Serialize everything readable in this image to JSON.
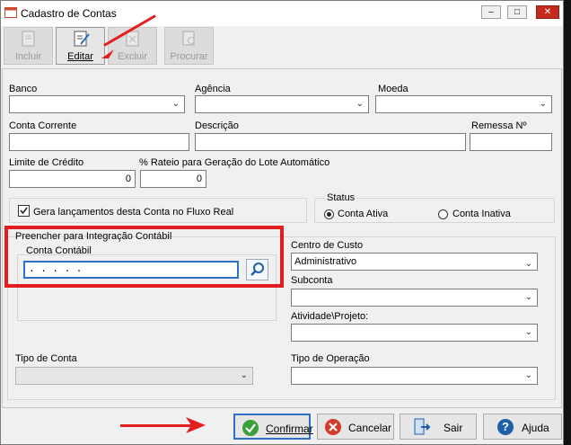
{
  "window": {
    "title": "Cadastro de Contas"
  },
  "toolbar": {
    "incluir": "Incluir",
    "editar": "Editar",
    "excluir": "Excluir",
    "procurar": "Procurar"
  },
  "labels": {
    "banco": "Banco",
    "agencia": "Agência",
    "moeda": "Moeda",
    "conta_corrente": "Conta Corrente",
    "descricao": "Descrição",
    "remessa": "Remessa Nº",
    "limite_credito": "Limite de Crédito",
    "rateio": "% Rateio para Geração do Lote Automático",
    "gera_lancamentos": "Gera lançamentos desta Conta no Fluxo Real",
    "status": "Status",
    "conta_ativa": "Conta Ativa",
    "conta_inativa": "Conta Inativa",
    "integracao": "Preencher para Integração Contábil",
    "conta_contabil": "Conta Contábil",
    "centro_custo": "Centro de Custo",
    "subconta": "Subconta",
    "atividade": "Atividade\\Projeto:",
    "tipo_conta": "Tipo de Conta",
    "tipo_operacao": "Tipo de Operação"
  },
  "values": {
    "limite_credito": "0",
    "rateio": "0",
    "conta_contabil": ". . . . .",
    "centro_custo": "Administrativo",
    "gera_lancamentos_checked": true,
    "status_selected": "Conta Ativa"
  },
  "footer": {
    "confirmar": "Confirmar",
    "cancelar": "Cancelar",
    "sair": "Sair",
    "ajuda": "Ajuda"
  },
  "colors": {
    "highlight": "#e41e1e",
    "confirm_icon": "#3aa03a",
    "cancel_icon": "#d23a2a",
    "help_icon": "#1f5fa8"
  }
}
